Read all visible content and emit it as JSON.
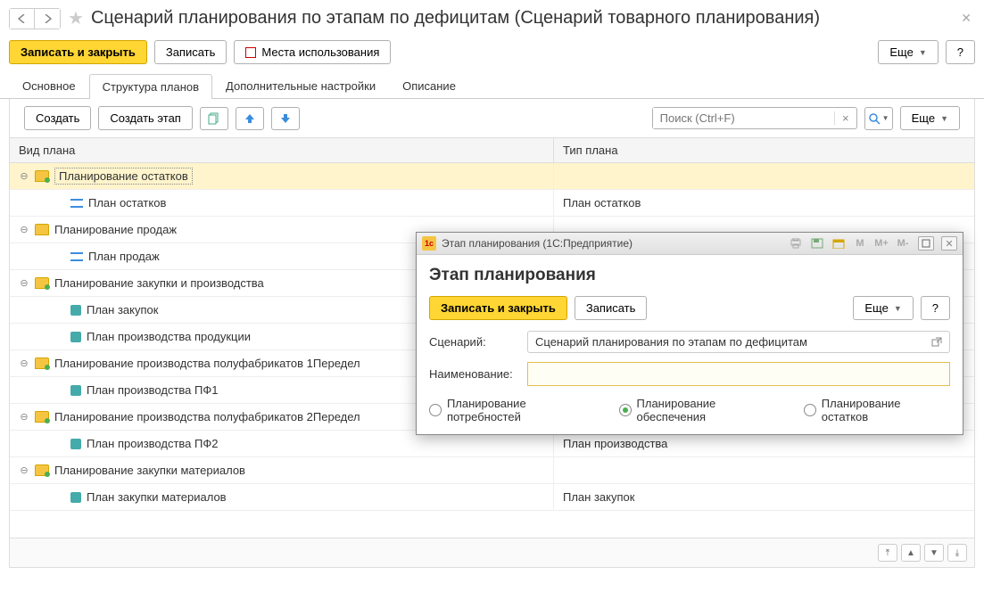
{
  "header": {
    "title": "Сценарий планирования по этапам по дефицитам (Сценарий товарного планирования)"
  },
  "main_toolbar": {
    "save_and_close": "Записать и закрыть",
    "save": "Записать",
    "usage_places": "Места использования",
    "more": "Еще",
    "help": "?"
  },
  "tabs": [
    {
      "label": "Основное",
      "active": false
    },
    {
      "label": "Структура планов",
      "active": true
    },
    {
      "label": "Дополнительные настройки",
      "active": false
    },
    {
      "label": "Описание",
      "active": false
    }
  ],
  "sub_toolbar": {
    "create": "Создать",
    "create_stage": "Создать этап",
    "search_placeholder": "Поиск (Ctrl+F)",
    "more": "Еще"
  },
  "tree": {
    "columns": {
      "name": "Вид плана",
      "type": "Тип плана"
    },
    "rows": [
      {
        "level": 0,
        "expand": true,
        "icon": "folder-green",
        "name": "Планирование остатков",
        "type": "",
        "selected": true
      },
      {
        "level": 1,
        "icon": "blue",
        "name": "План остатков",
        "type": "План остатков"
      },
      {
        "level": 0,
        "expand": true,
        "icon": "folder",
        "name": "Планирование продаж",
        "type": ""
      },
      {
        "level": 1,
        "icon": "blue",
        "name": "План продаж",
        "type": ""
      },
      {
        "level": 0,
        "expand": true,
        "icon": "folder-green",
        "name": "Планирование закупки и производства",
        "type": ""
      },
      {
        "level": 1,
        "icon": "teal",
        "name": "План закупок",
        "type": ""
      },
      {
        "level": 1,
        "icon": "teal",
        "name": "План производства продукции",
        "type": ""
      },
      {
        "level": 0,
        "expand": true,
        "icon": "folder-green",
        "name": "Планирование производства полуфабрикатов 1Передел",
        "type": ""
      },
      {
        "level": 1,
        "icon": "teal",
        "name": "План производства ПФ1",
        "type": ""
      },
      {
        "level": 0,
        "expand": true,
        "icon": "folder-green",
        "name": "Планирование производства полуфабрикатов 2Передел",
        "type": ""
      },
      {
        "level": 1,
        "icon": "teal",
        "name": "План производства ПФ2",
        "type": "План производства"
      },
      {
        "level": 0,
        "expand": true,
        "icon": "folder-green",
        "name": "Планирование закупки материалов",
        "type": ""
      },
      {
        "level": 1,
        "icon": "teal",
        "name": "План закупки материалов",
        "type": "План закупок"
      }
    ]
  },
  "dialog": {
    "window_title": "Этап планирования  (1С:Предприятие)",
    "heading": "Этап планирования",
    "save_and_close": "Записать и закрыть",
    "save": "Записать",
    "more": "Еще",
    "help": "?",
    "scenario_label": "Сценарий:",
    "scenario_value": "Сценарий планирования по этапам по дефицитам",
    "name_label": "Наименование:",
    "name_value": "",
    "radio": {
      "needs": "Планирование потребностей",
      "provision": "Планирование обеспечения",
      "remains": "Планирование остатков",
      "selected": "provision"
    },
    "titlebar_m": "M",
    "titlebar_mplus": "M+",
    "titlebar_mminus": "M-"
  }
}
